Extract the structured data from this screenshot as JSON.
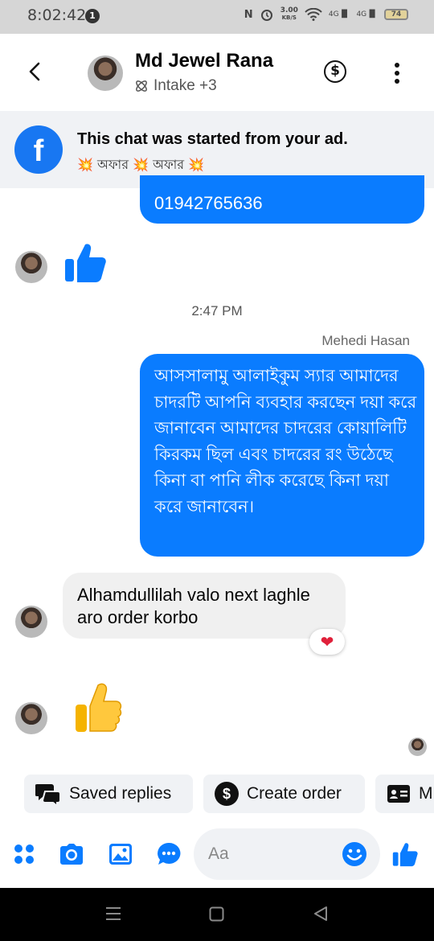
{
  "status_bar": {
    "time": "8:02:42",
    "notification_count": "1",
    "network_speed": "3.00",
    "network_speed_unit": "KB/S",
    "network_label_1": "4G",
    "network_label_2": "4G",
    "battery": "74"
  },
  "header": {
    "contact_name": "Md Jewel Rana",
    "label": "Intake +3"
  },
  "ad_banner": {
    "title": "This chat was started from your ad.",
    "subtitle": "💥 অফার 💥 অফার 💥"
  },
  "messages": {
    "phone_number": "01942765636",
    "timestamp": "2:47 PM",
    "sender_name": "Mehedi Hasan",
    "outgoing_message": "আসসালামু আলাইকুম স্যার আমাদের চাদরটি আপনি ব্যবহার করছেন দয়া করে জানাবেন আমাদের চাদরের কোয়ালিটি কিরকম ছিল এবং চাদরের রং উঠেছে কিনা বা পানি লীক করেছে কিনা দয়া করে জানাবেন।",
    "incoming_reply": "Alhamdullilah valo next laghle aro order korbo",
    "reaction": "❤"
  },
  "quick_replies": {
    "saved_replies": "Saved replies",
    "create_order": "Create order",
    "third": "M"
  },
  "composer": {
    "placeholder": "Aa"
  },
  "colors": {
    "messenger_blue": "#0a7cff",
    "facebook_blue": "#1877f2",
    "incoming_bubble": "#f0f0f0"
  }
}
